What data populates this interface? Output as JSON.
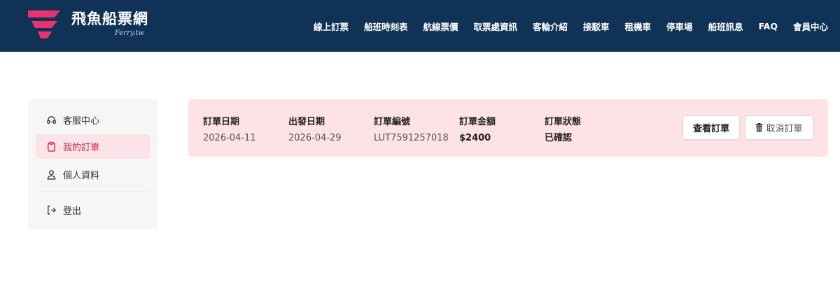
{
  "header": {
    "brand_name": "飛魚船票網",
    "brand_sub": "Ferry.tw",
    "nav": [
      "線上訂票",
      "船班時刻表",
      "航線票價",
      "取票處資訊",
      "客輪介紹",
      "接駁車",
      "租機車",
      "停車場",
      "船班訊息",
      "FAQ",
      "會員中心"
    ]
  },
  "sidebar": {
    "items": [
      {
        "label": "客服中心",
        "icon": "headset-icon"
      },
      {
        "label": "我的訂單",
        "icon": "clipboard-icon",
        "active": true
      },
      {
        "label": "個人資料",
        "icon": "user-icon"
      },
      {
        "label": "登出",
        "icon": "logout-icon"
      }
    ]
  },
  "order": {
    "order_date_label": "訂單日期",
    "order_date": "2026-04-11",
    "depart_date_label": "出發日期",
    "depart_date": "2026-04-29",
    "order_no_label": "訂單編號",
    "order_no": "LUT7591257018",
    "amount_label": "訂單金額",
    "amount": "$2400",
    "status_label": "訂單狀態",
    "status": "已確認",
    "view_button": "查看訂單",
    "cancel_button": "取消訂單"
  },
  "colors": {
    "header_bg": "#0f3256",
    "accent": "#d21f4f",
    "card_bg": "#fde2e6",
    "sidebar_bg": "#f6f6f7"
  }
}
